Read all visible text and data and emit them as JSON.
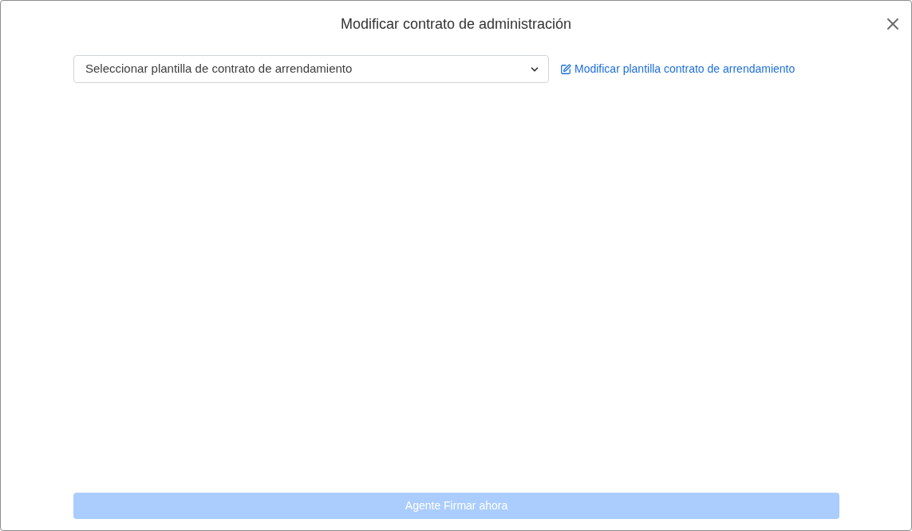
{
  "modal": {
    "title": "Modificar contrato de administración",
    "template_select": {
      "value": "Seleccionar plantilla de contrato de arrendamiento"
    },
    "edit_template_link": {
      "label": "Modificar plantilla contrato de arrendamiento"
    },
    "sign_button": {
      "label": "Agente Firmar ahora",
      "disabled": true
    }
  }
}
